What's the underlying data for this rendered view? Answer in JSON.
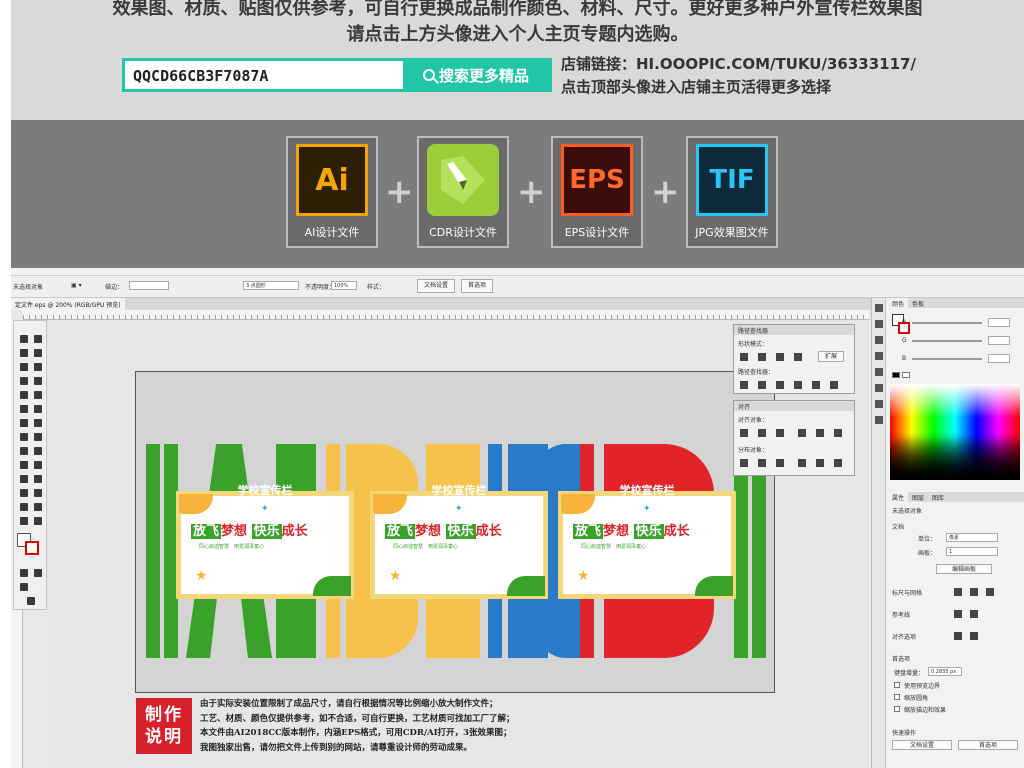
{
  "banner": {
    "line1": "效果图、材质、贴图仅供参考，可自行更换成品制作颜色、材料、尺寸。更好更多种户外宣传栏效果图",
    "line2": "请点击上方头像进入个人主页专题内选购。",
    "code": "QQCD66CB3F7087A",
    "search_label": "搜索更多精品",
    "shop_link": "店铺链接：HI.OOOPIC.COM/TUKU/36333117/",
    "shop_hint": "点击顶部头像进入店铺主页活得更多选择"
  },
  "formats": [
    {
      "icon": "Ai",
      "label": "AI设计文件"
    },
    {
      "icon": "",
      "label": "CDR设计文件"
    },
    {
      "icon": "EPS",
      "label": "EPS设计文件"
    },
    {
      "icon": "TIF",
      "label": "JPG效果图文件"
    }
  ],
  "control_bar": {
    "selection": "未选择对象",
    "stroke_label": "描边：",
    "brush": "3 点圆形",
    "opacity_label": "不透明度：",
    "opacity": "100%",
    "style_label": "样式：",
    "doc_setup": "文档设置",
    "prefs": "首选项"
  },
  "document": {
    "tab": "定文件.eps @ 200% (RGB/GPU 预览)"
  },
  "artwork": {
    "panel_title": "学校宣传栏",
    "slogan1a": "放飞",
    "slogan1b": "梦想",
    "slogan2a": "快乐",
    "slogan2b": "成长",
    "small_left": "同心启迪智慧",
    "small_right": "用爱润泽童心",
    "colors": {
      "green": "#3aa22a",
      "yellow": "#f7c24a",
      "blue": "#2b79c9",
      "red": "#e0242a"
    }
  },
  "pathfinder": {
    "title": "路径查找器",
    "shape_modes": "形状模式：",
    "expand": "扩展",
    "pathfinders": "路径查找器："
  },
  "align": {
    "title": "对齐",
    "align_objects": "对齐对象：",
    "distribute_objects": "分布对象："
  },
  "color_panel": {
    "tabs": [
      "颜色",
      "色板"
    ],
    "channels": [
      "R",
      "G",
      "B"
    ]
  },
  "properties": {
    "tabs": [
      "属性",
      "图层",
      "图库"
    ],
    "no_selection": "未选择对象",
    "document": "文档",
    "units_label": "单位：",
    "units_value": "像素",
    "artboard_label": "画板：",
    "artboard_value": "1",
    "edit_artboard": "编辑画板",
    "rulers_grids": "标尺与网格",
    "guides": "参考线",
    "align_options": "对齐选项",
    "preferences": "首选项",
    "keyboard_increment_label": "键盘增量：",
    "keyboard_increment": "0.2835 px",
    "use_preview_bounds": "使用预览边界",
    "scale_corners": "缩放圆角",
    "scale_strokes": "缩放描边和效果",
    "quick_actions": "快速操作",
    "doc_setup": "文档设置",
    "prefs": "首选项"
  },
  "notes": {
    "badge_line1": "制作",
    "badge_line2": "说明",
    "lines": [
      "由于实际安装位置限制了成品尺寸，请自行根据情况等比例缩小放大制作文件；",
      "工艺、材质、颜色仅提供参考，如不合适，可自行更换，工艺材质可找加工厂了解；",
      "本文件由AI2018CC版本制作，内涵EPS格式，可用CDR/AI打开，3张效果图；",
      "我图独家出售，请勿把文件上传到别的网站，请尊重设计师的劳动成果。"
    ]
  }
}
